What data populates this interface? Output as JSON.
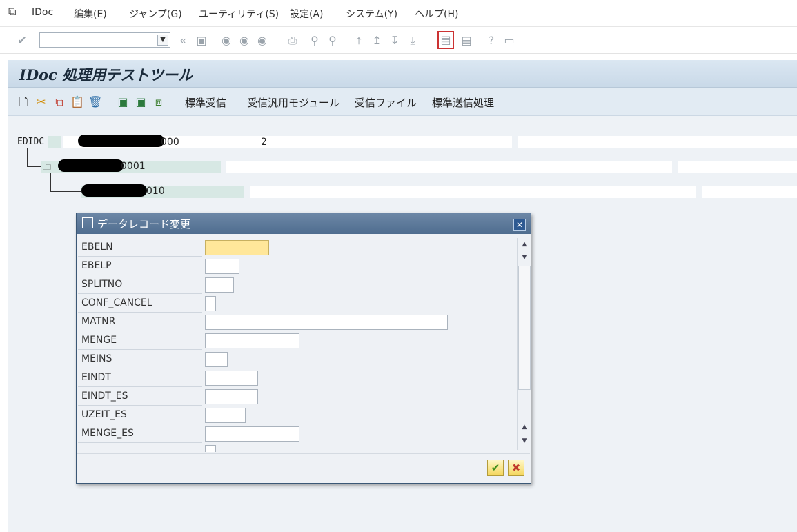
{
  "menubar": {
    "items": [
      "IDoc",
      "編集(E)",
      "ジャンプ(G)",
      "ユーティリティ(S)",
      "設定(A)",
      "システム(Y)",
      "ヘルプ(H)"
    ]
  },
  "toolbar": {
    "command_value": "",
    "icons": [
      "check-icon",
      "back-icon",
      "save-icon",
      "nav-back-icon",
      "nav-exit-icon",
      "nav-cancel-icon",
      "print-icon",
      "find-icon",
      "find-next-icon",
      "first-page-icon",
      "prev-page-icon",
      "next-page-icon",
      "last-page-icon",
      "new-session-icon",
      "shortcut-icon",
      "help-icon",
      "layout-icon"
    ]
  },
  "header": {
    "title": "IDoc 処理用テストツール"
  },
  "appbar": {
    "buttons": [
      "標準受信",
      "受信汎用モジュール",
      "受信ファイル",
      "標準送信処理"
    ]
  },
  "tree": {
    "root_label": "EDIDC",
    "root_value": "000",
    "root_count": "2",
    "child1_value": "0001",
    "child2_value": "010"
  },
  "dialog": {
    "title": "データレコード変更",
    "fields": [
      {
        "label": "EBELN",
        "value": ""
      },
      {
        "label": "EBELP",
        "value": ""
      },
      {
        "label": "SPLITNO",
        "value": ""
      },
      {
        "label": "CONF_CANCEL",
        "value": ""
      },
      {
        "label": "MATNR",
        "value": ""
      },
      {
        "label": "MENGE",
        "value": ""
      },
      {
        "label": "MEINS",
        "value": ""
      },
      {
        "label": "EINDT",
        "value": ""
      },
      {
        "label": "EINDT_ES",
        "value": ""
      },
      {
        "label": "UZEIT_ES",
        "value": ""
      },
      {
        "label": "MENGE_ES",
        "value": ""
      }
    ],
    "confirm_label": "✔",
    "cancel_label": "✖"
  },
  "colors": {
    "accent_header": "#c9d9e8",
    "dialog_header": "#4f6d8f",
    "field_highlight": "#ffe79a"
  }
}
